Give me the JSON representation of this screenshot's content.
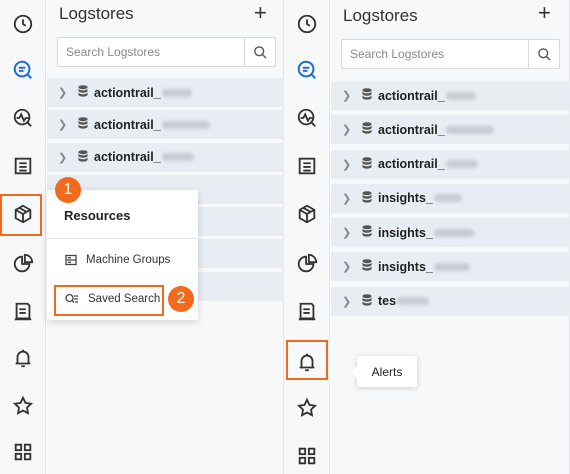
{
  "left": {
    "rail_icons": [
      "clock-icon",
      "query-icon",
      "monitor-icon",
      "list-icon",
      "package-icon",
      "pie-chart-icon",
      "report-icon",
      "bell-icon",
      "star-icon",
      "grid-icon"
    ],
    "title": "Logstores",
    "plus": "+",
    "search_placeholder": "Search Logstores",
    "items": [
      {
        "prefix": "actiontrail_"
      },
      {
        "prefix": "actiontrail_"
      },
      {
        "prefix": "actiontrail_"
      }
    ],
    "popup": {
      "header": "Resources",
      "machine_groups": "Machine Groups",
      "saved_search": "Saved Search"
    },
    "badge1": "1",
    "badge2": "2"
  },
  "right": {
    "rail_icons": [
      "clock-icon",
      "query-icon",
      "monitor-icon",
      "list-icon",
      "package-icon",
      "pie-chart-icon",
      "report-icon",
      "bell-icon",
      "star-icon",
      "grid-icon"
    ],
    "title": "Logstores",
    "plus": "+",
    "search_placeholder": "Search Logstores",
    "items": [
      {
        "prefix": "actiontrail_"
      },
      {
        "prefix": "actiontrail_"
      },
      {
        "prefix": "actiontrail_"
      },
      {
        "prefix": "insights_"
      },
      {
        "prefix": "insights_"
      },
      {
        "prefix": "insights_"
      },
      {
        "prefix": "tes"
      }
    ],
    "tooltip": "Alerts"
  },
  "colors": {
    "accent": "#1f6fd6",
    "highlight": "#f26b1d",
    "row_bg": "#e8ecf3"
  }
}
